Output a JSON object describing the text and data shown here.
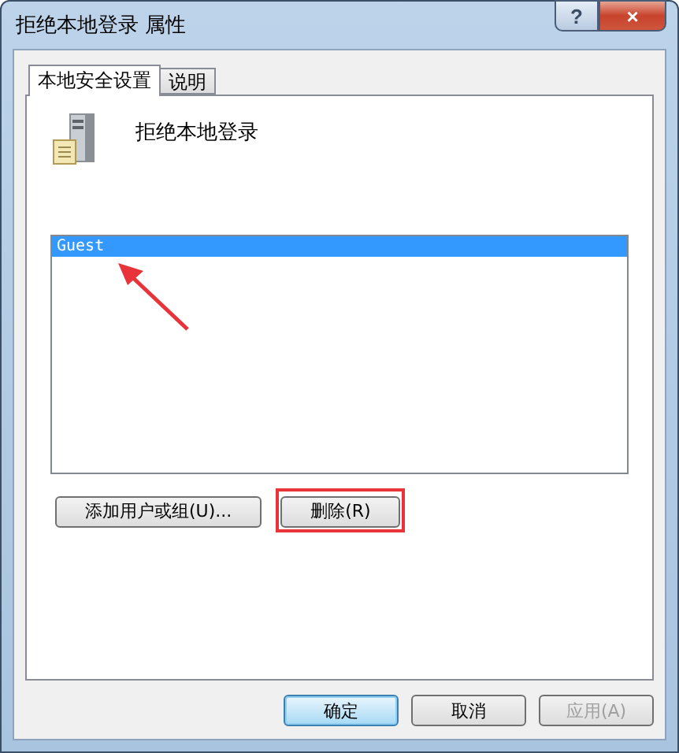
{
  "window": {
    "title": "拒绝本地登录 属性",
    "help_button": "?",
    "close_button": "×"
  },
  "tabs": [
    {
      "label": "本地安全设置",
      "selected": true
    },
    {
      "label": "说明",
      "selected": false
    }
  ],
  "policy": {
    "name": "拒绝本地登录"
  },
  "user_list": [
    {
      "name": "Guest",
      "selected": true
    }
  ],
  "list_buttons": [
    {
      "label": "添加用户或组(U)...",
      "disabled": false,
      "highlighted": false
    },
    {
      "label": "删除(R)",
      "disabled": false,
      "highlighted": true
    }
  ],
  "dialog_buttons": [
    {
      "label": "确定",
      "disabled": false,
      "default": true
    },
    {
      "label": "取消",
      "disabled": false,
      "default": false
    },
    {
      "label": "应用(A)",
      "disabled": true,
      "default": false
    }
  ]
}
